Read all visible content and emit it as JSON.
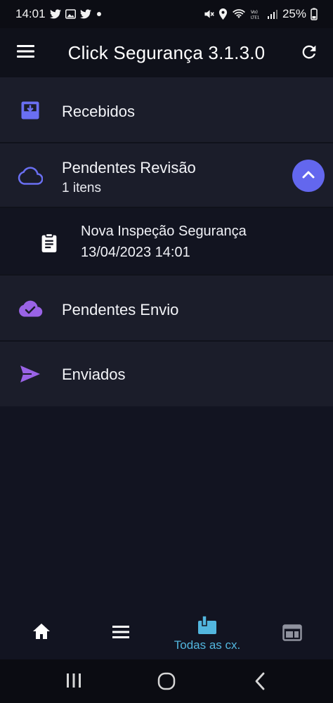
{
  "status_bar": {
    "time": "14:01",
    "battery": "25%",
    "left_icons": [
      "twitter-icon",
      "image-icon",
      "twitter-icon",
      "dot-icon"
    ],
    "right_icons": [
      "mute-icon",
      "location-icon",
      "wifi-icon",
      "volte-icon",
      "signal-icon"
    ]
  },
  "app_bar": {
    "title": "Click Segurança 3.1.3.0",
    "menu_icon": "hamburger-menu-icon",
    "refresh_icon": "refresh-icon"
  },
  "folders": {
    "recebidos": {
      "label": "Recebidos",
      "icon": "inbox-download-icon",
      "color": "#6a6ff2"
    },
    "pendentes_revisao": {
      "label": "Pendentes Revisão",
      "count_text": "1 itens",
      "icon": "cloud-outline-icon",
      "color": "#6a6ff2",
      "expanded": true,
      "items": [
        {
          "title": "Nova Inspeção Segurança",
          "date": "13/04/2023 14:01",
          "icon": "clipboard-icon"
        }
      ]
    },
    "pendentes_envio": {
      "label": "Pendentes Envio",
      "icon": "cloud-check-icon",
      "color": "#9a63e6"
    },
    "enviados": {
      "label": "Enviados",
      "icon": "send-icon",
      "color": "#9a63e6"
    }
  },
  "bottom_nav": {
    "items": [
      {
        "id": "home",
        "icon": "home-icon",
        "label": ""
      },
      {
        "id": "list",
        "icon": "list-icon",
        "label": ""
      },
      {
        "id": "all",
        "icon": "mailbox-icon",
        "label": "Todas as cx.",
        "active": true,
        "color": "#52b6de"
      },
      {
        "id": "web",
        "icon": "web-window-icon",
        "label": ""
      }
    ]
  },
  "system_nav": [
    "recent-apps-icon",
    "home-circle-icon",
    "back-chevron-icon"
  ]
}
